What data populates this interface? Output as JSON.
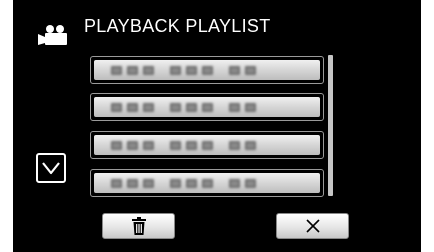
{
  "header": {
    "title": "PLAYBACK PLAYLIST",
    "mode_icon": "video-camera-icon"
  },
  "playlist": {
    "items": [
      {
        "label_icon": "blurred-playlist-name"
      },
      {
        "label_icon": "blurred-playlist-name"
      },
      {
        "label_icon": "blurred-playlist-name"
      },
      {
        "label_icon": "blurred-playlist-name"
      }
    ]
  },
  "navigation": {
    "scroll_down_icon": "chevron-down-icon"
  },
  "footer": {
    "delete_icon": "trash-icon",
    "close_icon": "close-icon"
  },
  "colors": {
    "background": "#000000",
    "text": "#ffffff",
    "button_face": "#e6e6e6"
  }
}
